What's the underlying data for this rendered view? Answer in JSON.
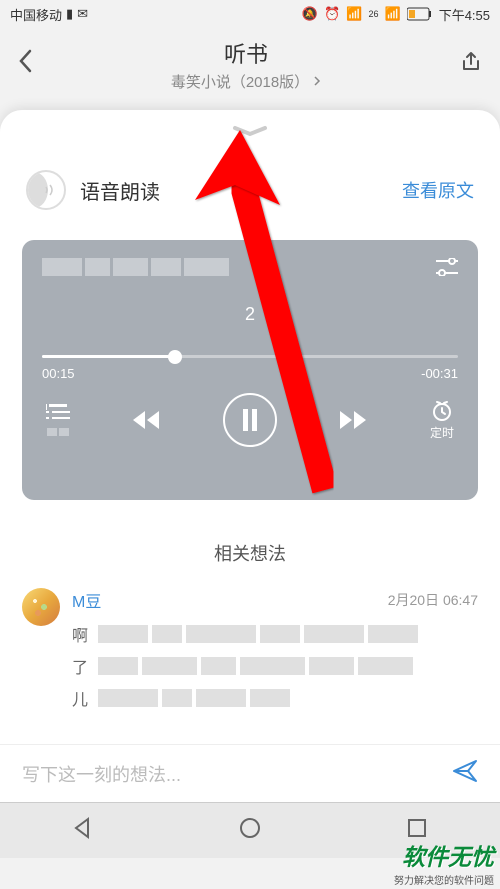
{
  "status": {
    "carrier": "中国移动",
    "time": "下午4:55",
    "network": "26"
  },
  "nav": {
    "title": "听书",
    "subtitle": "毒笑小说（2018版）"
  },
  "tts": {
    "title": "语音朗读",
    "view_original": "查看原文"
  },
  "player": {
    "chapter": "2",
    "elapsed": "00:15",
    "remaining": "-00:31",
    "timer_label": "定时"
  },
  "related": {
    "header": "相关想法"
  },
  "thought": {
    "user": "M豆",
    "time": "2月20日 06:47",
    "line_chars": [
      "啊",
      "了",
      "儿"
    ]
  },
  "comment": {
    "placeholder": "写下这一刻的想法..."
  },
  "watermark": {
    "main": "软件无忧",
    "sub": "努力解决您的软件问题"
  },
  "colors": {
    "accent": "#3b8cd8",
    "arrow": "#ff0000"
  }
}
